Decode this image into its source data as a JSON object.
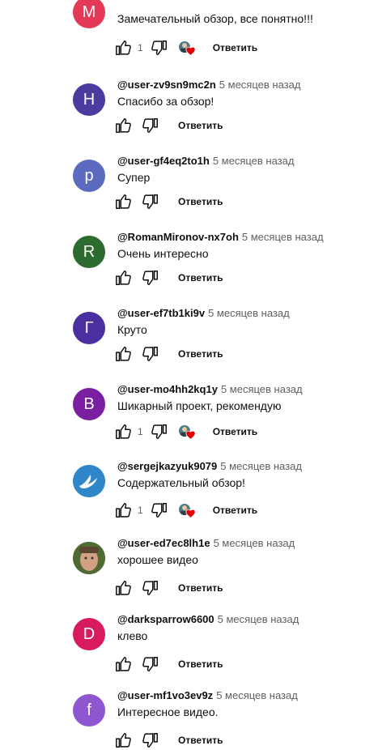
{
  "comments": [
    {
      "letter": "M",
      "color": "#e53958",
      "author": "",
      "time": "",
      "text": "Замечательный обзор, все понятно!!!",
      "likes": "1",
      "hearted": true
    },
    {
      "letter": "Н",
      "color": "#4a3b9e",
      "author": "@user-zv9sn9mc2n",
      "time": "5 месяцев назад",
      "text": "Спасибо за обзор!",
      "likes": "",
      "hearted": false
    },
    {
      "letter": "р",
      "color": "#5c6bc0",
      "author": "@user-gf4eq2to1h",
      "time": "5 месяцев назад",
      "text": "Супер",
      "likes": "",
      "hearted": false
    },
    {
      "letter": "R",
      "color": "#2e6b2e",
      "author": "@RomanMironov-nx7oh",
      "time": "5 месяцев назад",
      "text": "Очень интересно",
      "likes": "",
      "hearted": false
    },
    {
      "letter": "Г",
      "color": "#4a2fa0",
      "author": "@user-ef7tb1ki9v",
      "time": "5 месяцев назад",
      "text": "Круто",
      "likes": "",
      "hearted": false
    },
    {
      "letter": "B",
      "color": "#7b1fa2",
      "author": "@user-mo4hh2kq1y",
      "time": "5 месяцев назад",
      "text": "Шикарный проект, рекомендую",
      "likes": "1",
      "hearted": true
    },
    {
      "letter": "",
      "color": "#2f86c8",
      "author": "@sergejkazyuk9079",
      "time": "5 месяцев назад",
      "text": "Содержательный обзор!",
      "likes": "1",
      "hearted": true,
      "avatar_kind": "bird"
    },
    {
      "letter": "",
      "color": "#5a6b3a",
      "author": "@user-ed7ec8lh1e",
      "time": "5 месяцев назад",
      "text": "хорошее видео",
      "likes": "",
      "hearted": false,
      "avatar_kind": "photo"
    },
    {
      "letter": "D",
      "color": "#d81b60",
      "author": "@darksparrow6600",
      "time": "5 месяцев назад",
      "text": "клево",
      "likes": "",
      "hearted": false
    },
    {
      "letter": "f",
      "color": "#8e57d0",
      "author": "@user-mf1vo3ev9z",
      "time": "5 месяцев назад",
      "text": "Интересное видео.",
      "likes": "",
      "hearted": false
    }
  ],
  "ui": {
    "reply_label": "Ответить"
  }
}
